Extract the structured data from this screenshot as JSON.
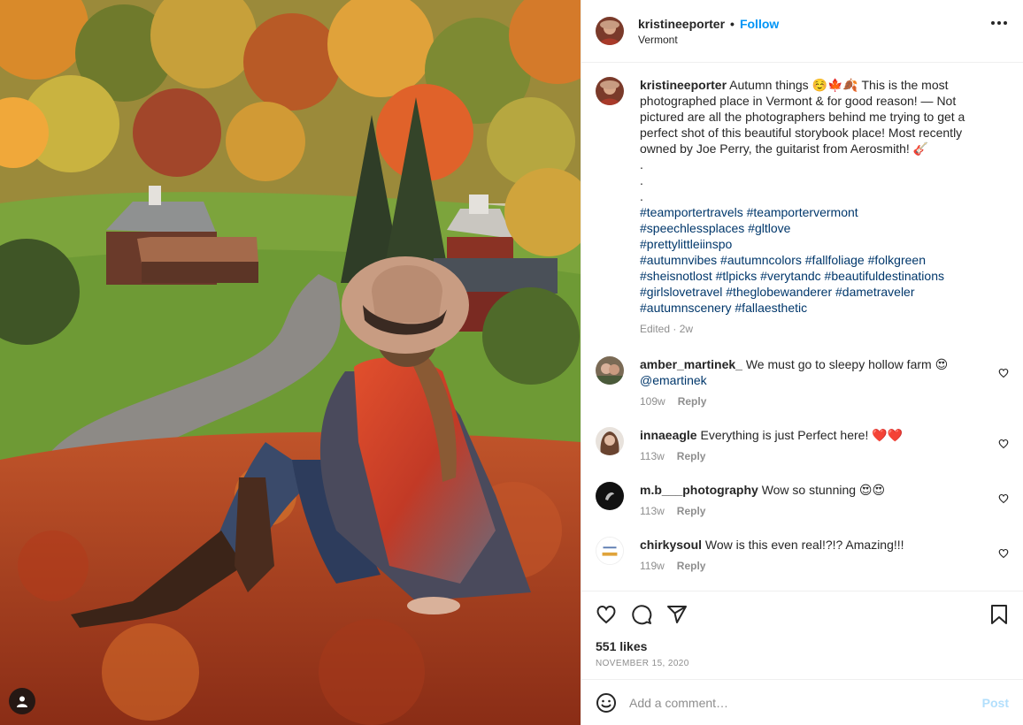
{
  "post": {
    "username": "kristineeporter",
    "follow_label": "Follow",
    "location": "Vermont",
    "caption_first": "Autumn things ☺️🍁🍂 This is the most",
    "caption_lines": [
      "photographed place in Vermont & for good reason! — Not",
      "pictured are all the photographers behind me trying to get a",
      "perfect shot of this beautiful storybook place! Most recently",
      "owned by Joe Perry, the guitarist from Aerosmith! 🎸",
      ".",
      ".",
      "."
    ],
    "hashtag_lines": [
      "#teamportertravels #teamportervermont",
      "#speechlessplaces #gltlove",
      "#prettylittleiinspo",
      "#autumnvibes #autumncolors #fallfoliage #folkgreen",
      "#sheisnotlost #tlpicks #verytandc #beautifuldestinations",
      "#girlslovetravel #theglobewanderer #dametraveler",
      "#autumnscenery #fallaesthetic"
    ],
    "edited_meta": "Edited · 2w"
  },
  "comments": [
    {
      "username": "amber_martinek_",
      "text": "We must go to sleepy hollow farm 😍",
      "text2": "@emartinek",
      "time": "109w",
      "reply": "Reply",
      "avatar_color": "#7a6a55"
    },
    {
      "username": "innaeagle",
      "text": "Everything is just Perfect here! ❤️❤️",
      "text2": "",
      "time": "113w",
      "reply": "Reply",
      "avatar_color": "#a8806a"
    },
    {
      "username": "m.b___photography",
      "text": "Wow so stunning 😍😍",
      "text2": "",
      "time": "113w",
      "reply": "Reply",
      "avatar_color": "#111111"
    },
    {
      "username": "chirkysoul",
      "text": "Wow is this even real!?!? Amazing!!!",
      "text2": "",
      "time": "119w",
      "reply": "Reply",
      "avatar_color": "#ffffff"
    }
  ],
  "actions": {
    "likes": "551 likes",
    "date": "NOVEMBER 15, 2020",
    "icons": [
      "heart-icon",
      "comment-icon",
      "share-icon",
      "bookmark-icon"
    ]
  },
  "composer": {
    "placeholder": "Add a comment…",
    "post_label": "Post"
  },
  "colors": {
    "link_blue": "#0095f6",
    "hashtag": "#00376b",
    "muted": "#8e8e8e",
    "post_disabled": "#b2dffc"
  }
}
